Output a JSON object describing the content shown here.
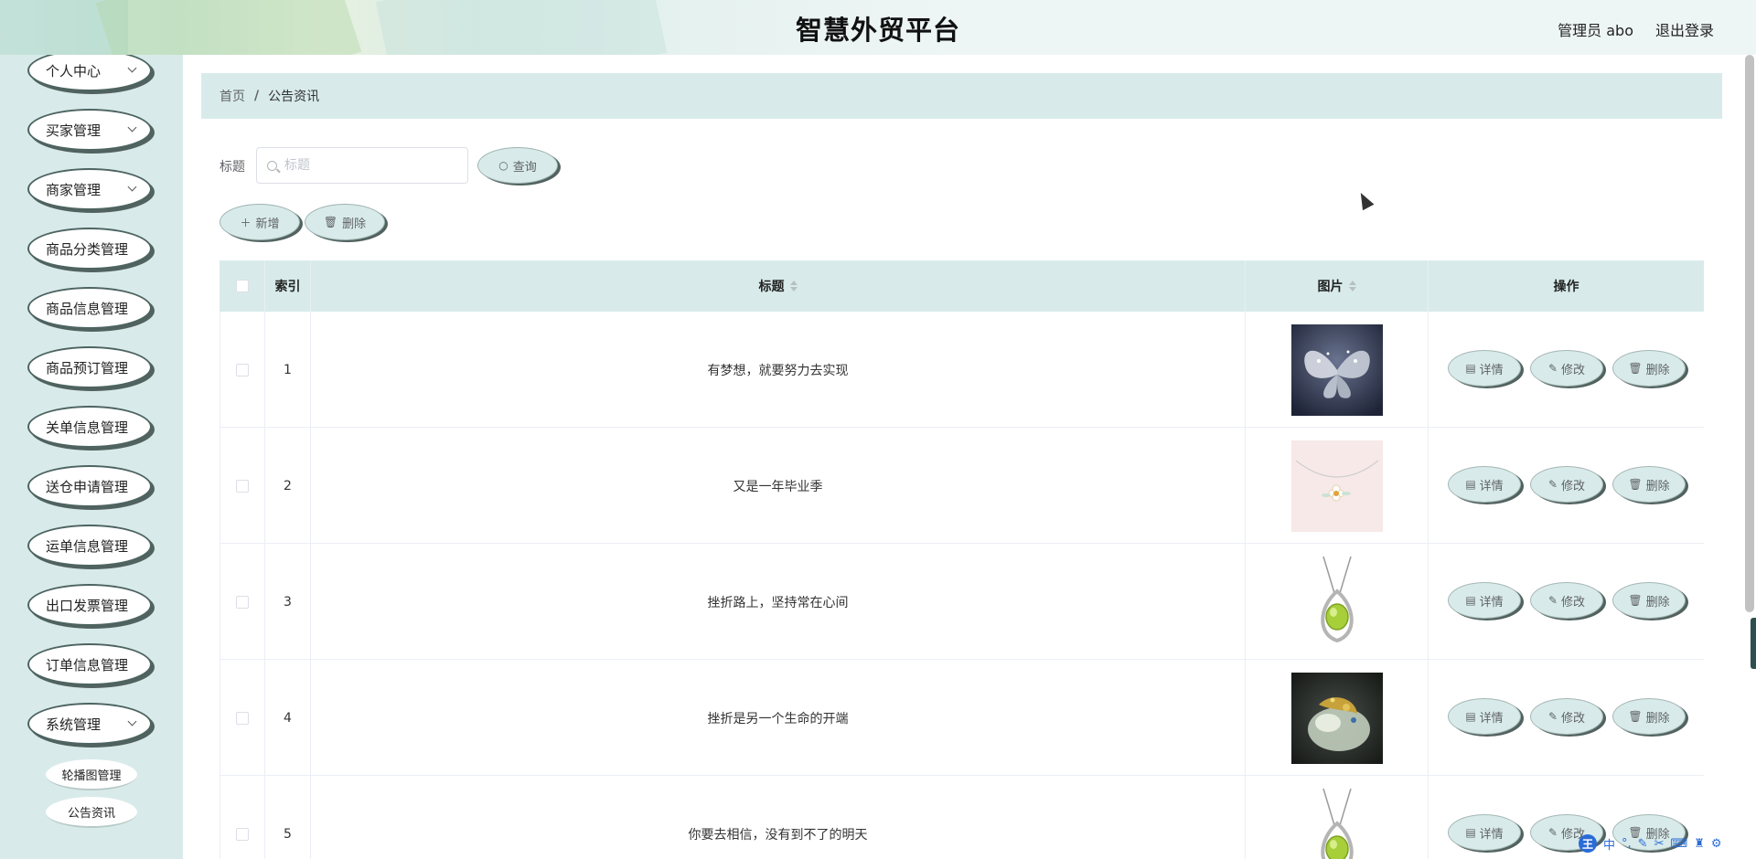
{
  "header": {
    "title": "智慧外贸平台",
    "user": "管理员 abo",
    "logout": "退出登录"
  },
  "sidebar": {
    "items": [
      {
        "label": "个人中心",
        "has_submenu": true
      },
      {
        "label": "买家管理",
        "has_submenu": true
      },
      {
        "label": "商家管理",
        "has_submenu": true
      },
      {
        "label": "商品分类管理",
        "has_submenu": false
      },
      {
        "label": "商品信息管理",
        "has_submenu": false
      },
      {
        "label": "商品预订管理",
        "has_submenu": false
      },
      {
        "label": "关单信息管理",
        "has_submenu": false
      },
      {
        "label": "送仓申请管理",
        "has_submenu": false
      },
      {
        "label": "运单信息管理",
        "has_submenu": false
      },
      {
        "label": "出口发票管理",
        "has_submenu": false
      },
      {
        "label": "订单信息管理",
        "has_submenu": false
      },
      {
        "label": "系统管理",
        "has_submenu": true
      }
    ],
    "sub_items": [
      {
        "label": "轮播图管理"
      },
      {
        "label": "公告资讯"
      }
    ]
  },
  "breadcrumb": {
    "home": "首页",
    "separator": "/",
    "current": "公告资讯"
  },
  "search": {
    "label": "标题",
    "placeholder": "标题",
    "query_button": "查询"
  },
  "toolbar": {
    "add_button": "新增",
    "delete_button": "删除"
  },
  "table": {
    "columns": {
      "index": "索引",
      "title": "标题",
      "image": "图片",
      "actions": "操作"
    },
    "rows": [
      {
        "index": "1",
        "title": "有梦想，就要努力去实现",
        "image": "butterfly-brooch"
      },
      {
        "index": "2",
        "title": "又是一年毕业季",
        "image": "flower-necklace"
      },
      {
        "index": "3",
        "title": "挫折路上，坚持常在心间",
        "image": "peridot-pendant"
      },
      {
        "index": "4",
        "title": "挫折是另一个生命的开端",
        "image": "jade-ornament"
      },
      {
        "index": "5",
        "title": "你要去相信，没有到不了的明天",
        "image": "peridot-pendant"
      }
    ],
    "row_actions": {
      "detail": "详情",
      "edit": "修改",
      "delete": "删除"
    }
  },
  "ime": {
    "mode": "中"
  },
  "colors": {
    "accent": "#d8ebea",
    "button_shadow": "#51625f"
  }
}
